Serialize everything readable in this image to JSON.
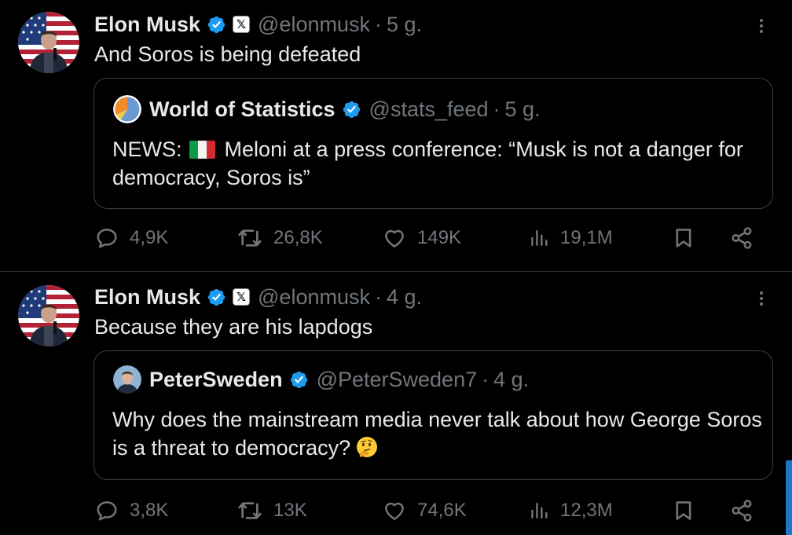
{
  "tweets": [
    {
      "author": "Elon Musk",
      "handle": "@elonmusk",
      "separator": "·",
      "time": "5 g.",
      "text": "And Soros is being defeated",
      "quote": {
        "author": "World of Statistics",
        "handle": "@stats_feed",
        "separator": "·",
        "time": "5 g.",
        "text_before": "NEWS:",
        "text_after": "Meloni at a press conference:  “Musk is not a danger for democracy, Soros is”",
        "flag": "italy-flag"
      },
      "stats": {
        "replies": "4,9K",
        "retweets": "26,8K",
        "likes": "149K",
        "views": "19,1M"
      }
    },
    {
      "author": "Elon Musk",
      "handle": "@elonmusk",
      "separator": "·",
      "time": "4 g.",
      "text": "Because they are his lapdogs",
      "quote": {
        "author": "PeterSweden",
        "handle": "@PeterSweden7",
        "separator": "·",
        "time": "4 g.",
        "text": "Why does the mainstream media never talk about how George Soros is a threat to democracy?",
        "emoji": "thinking-face-emoji"
      },
      "stats": {
        "replies": "3,8K",
        "retweets": "13K",
        "likes": "74,6K",
        "views": "12,3M"
      }
    }
  ],
  "affiliate_badge": "𝕏",
  "icons": {
    "verified": "verified-badge-icon",
    "more": "more-options-icon",
    "reply": "reply-icon",
    "retweet": "retweet-icon",
    "like": "heart-icon",
    "views": "views-chart-icon",
    "bookmark": "bookmark-icon",
    "share": "share-icon"
  },
  "colors": {
    "background": "#000000",
    "text": "#e7e9ea",
    "secondary": "#71767b",
    "verified": "#1d9bf0",
    "border": "#2f3336"
  }
}
